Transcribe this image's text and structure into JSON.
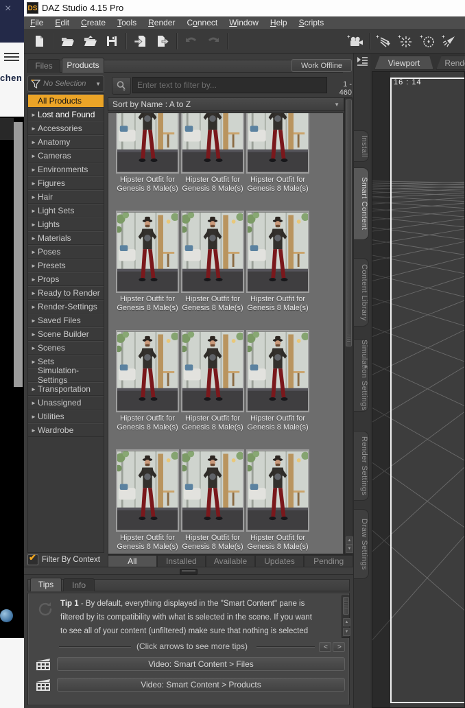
{
  "icons": {
    "close": "×",
    "expand_arrow": "►",
    "dropdown_arrow": "▼",
    "up_arrow": "▲",
    "down_arrow": "▼",
    "check": "✔"
  },
  "background_window": {
    "partial_text": "chen"
  },
  "titlebar": {
    "logo": "DS",
    "title": "DAZ Studio 4.15 Pro"
  },
  "menubar": {
    "items": [
      {
        "pre": "",
        "key": "F",
        "post": "ile"
      },
      {
        "pre": "",
        "key": "E",
        "post": "dit"
      },
      {
        "pre": "",
        "key": "C",
        "post": "reate"
      },
      {
        "pre": "",
        "key": "T",
        "post": "ools"
      },
      {
        "pre": "",
        "key": "R",
        "post": "ender"
      },
      {
        "pre": "C",
        "key": "o",
        "post": "nnect"
      },
      {
        "pre": "",
        "key": "W",
        "post": "indow"
      },
      {
        "pre": "",
        "key": "H",
        "post": "elp"
      },
      {
        "pre": "",
        "key": "S",
        "post": "cripts"
      }
    ]
  },
  "toolbar": {
    "icons": [
      "new-file",
      "open-folder",
      "open-recent-folder",
      "save",
      "import",
      "export",
      "undo",
      "redo",
      "new-camera",
      "new-distant-light",
      "new-point-light",
      "new-environment",
      "new-spotlight"
    ]
  },
  "smart_content": {
    "tabs": [
      {
        "label": "Files",
        "active": false
      },
      {
        "label": "Products",
        "active": true
      }
    ],
    "work_offline_label": "Work Offline",
    "filter_dropdown": {
      "label": "No Selection"
    },
    "search": {
      "placeholder": "Enter text to filter by...",
      "value": "",
      "count": "1 - 460"
    },
    "sort": {
      "label": "Sort by Name : A to Z"
    },
    "categories": [
      {
        "label": "All Products",
        "arrow": false,
        "selected": true
      },
      {
        "label": "Lost and Found",
        "arrow": true,
        "cls": "bright"
      },
      {
        "label": "Accessories",
        "arrow": true
      },
      {
        "label": "Anatomy",
        "arrow": true
      },
      {
        "label": "Cameras",
        "arrow": true
      },
      {
        "label": "Environments",
        "arrow": true
      },
      {
        "label": "Figures",
        "arrow": true
      },
      {
        "label": "Hair",
        "arrow": true
      },
      {
        "label": "Light Sets",
        "arrow": true
      },
      {
        "label": "Lights",
        "arrow": true
      },
      {
        "label": "Materials",
        "arrow": true
      },
      {
        "label": "Poses",
        "arrow": true
      },
      {
        "label": "Presets",
        "arrow": true
      },
      {
        "label": "Props",
        "arrow": true
      },
      {
        "label": "Ready to Render",
        "arrow": true
      },
      {
        "label": "Render-Settings",
        "arrow": true
      },
      {
        "label": "Saved Files",
        "arrow": true
      },
      {
        "label": "Scene Builder",
        "arrow": true
      },
      {
        "label": "Scenes",
        "arrow": true
      },
      {
        "label": "Sets",
        "arrow": true
      },
      {
        "label": "Simulation-Settings",
        "arrow": false
      },
      {
        "label": "Transportation",
        "arrow": true
      },
      {
        "label": "Unassigned",
        "arrow": true
      },
      {
        "label": "Utilities",
        "arrow": true
      },
      {
        "label": "Wardrobe",
        "arrow": true
      }
    ],
    "filter_by_context": {
      "label": "Filter By Context",
      "checked": true
    },
    "products": {
      "items": [
        {
          "l1": "Hipster Outfit for",
          "l2": "Genesis 8 Male(s)"
        },
        {
          "l1": "Hipster Outfit for",
          "l2": "Genesis 8 Male(s)"
        },
        {
          "l1": "Hipster Outfit for",
          "l2": "Genesis 8 Male(s)"
        },
        {
          "l1": "Hipster Outfit for",
          "l2": "Genesis 8 Male(s)"
        },
        {
          "l1": "Hipster Outfit for",
          "l2": "Genesis 8 Male(s)"
        },
        {
          "l1": "Hipster Outfit for",
          "l2": "Genesis 8 Male(s)"
        },
        {
          "l1": "Hipster Outfit for",
          "l2": "Genesis 8 Male(s)"
        },
        {
          "l1": "Hipster Outfit for",
          "l2": "Genesis 8 Male(s)"
        },
        {
          "l1": "Hipster Outfit for",
          "l2": "Genesis 8 Male(s)"
        },
        {
          "l1": "Hipster Outfit for",
          "l2": "Genesis 8 Male(s)"
        },
        {
          "l1": "Hipster Outfit for",
          "l2": "Genesis 8 Male(s)"
        },
        {
          "l1": "Hipster Outfit for",
          "l2": "Genesis 8 Male(s)"
        }
      ]
    },
    "status_tabs": [
      {
        "label": "All",
        "active": true
      },
      {
        "label": "Installed",
        "active": false
      },
      {
        "label": "Available",
        "active": false
      },
      {
        "label": "Updates",
        "active": false
      },
      {
        "label": "Pending",
        "active": false
      }
    ]
  },
  "tips_pane": {
    "tabs": [
      {
        "label": "Tips",
        "active": true
      },
      {
        "label": "Info",
        "active": false
      }
    ],
    "tip": {
      "title": "Tip 1",
      "line1_rest": " - By default, everything displayed in the \"Smart Content\" pane is",
      "line2": "filtered by its compatibility with what is selected in the scene. If you want",
      "line3": "to see all of your content (unfiltered) make sure that nothing is selected"
    },
    "more_tips_label": "(Click arrows to see more tips)",
    "prev_label": "<",
    "next_label": ">",
    "videos": [
      {
        "label": "Video: Smart Content > Files"
      },
      {
        "label": "Video: Smart Content > Products"
      }
    ]
  },
  "side_tabs": {
    "items": [
      {
        "label": "Install",
        "active": false
      },
      {
        "label": "Smart Content",
        "active": true
      },
      {
        "label": "Content Library",
        "active": false
      },
      {
        "label": "Simulation Settings",
        "active": false
      },
      {
        "label": "Render Settings",
        "active": false
      },
      {
        "label": "Draw Settings",
        "active": false
      }
    ]
  },
  "viewport": {
    "tabs": [
      {
        "label": "Viewport",
        "active": true
      },
      {
        "label": "Rende",
        "active": false
      }
    ],
    "aspect_label": "16 : 14"
  },
  "colors": {
    "accent_yellow": "#eba427",
    "check_yellow": "#f2a71f",
    "pane_bg": "#3c3c3c",
    "viewport_bg": "#3d3d3d",
    "grid_line": "#6b6b6b",
    "pants_red": "#7a181c"
  }
}
